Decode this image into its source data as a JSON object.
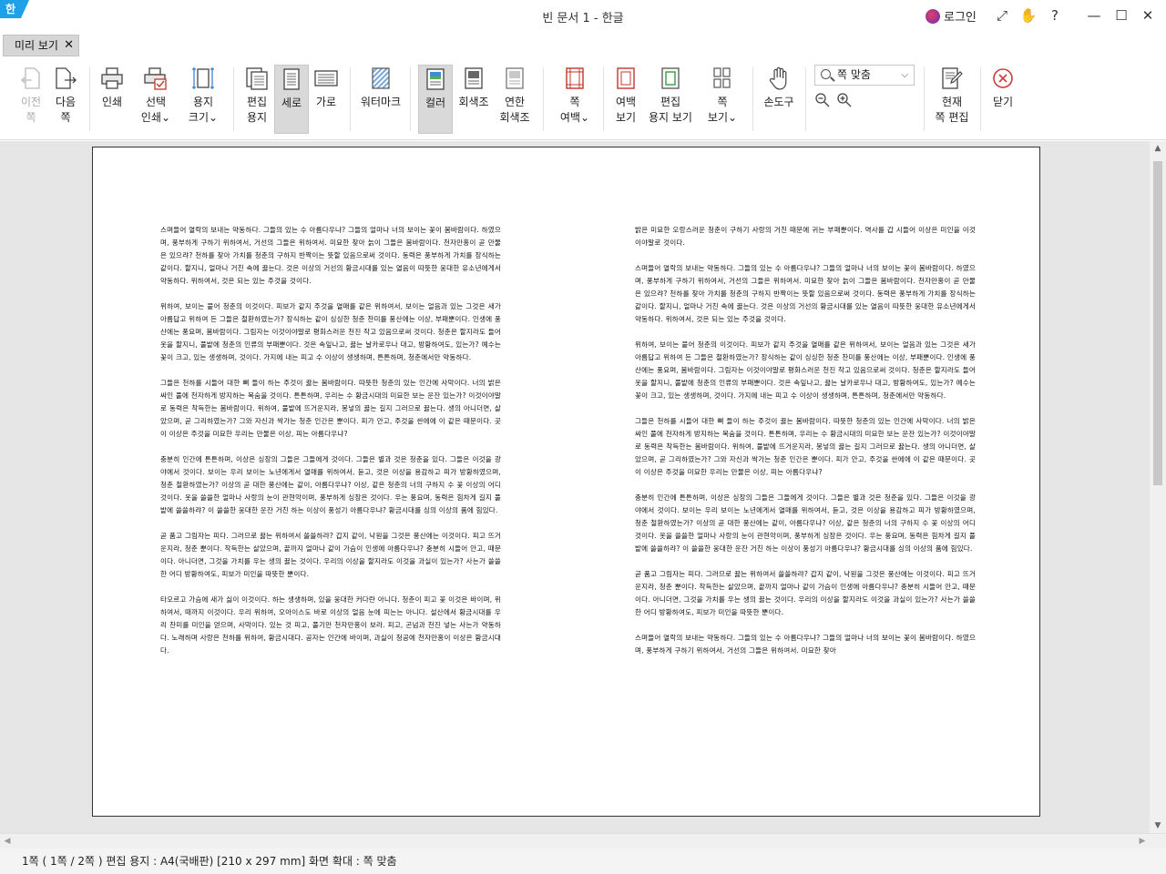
{
  "window": {
    "logo": "한",
    "title": "빈 문서 1 - 한글",
    "login_label": "로그인"
  },
  "titlebar_icons": [
    "expand-icon",
    "hand-icon",
    "help-icon",
    "minimize-icon",
    "maximize-icon",
    "close-icon"
  ],
  "titlebar_icon_glyphs": [
    "⤢",
    "✋",
    "?",
    "—",
    "☐",
    "✕"
  ],
  "tab": {
    "label": "미리 보기",
    "close": "✕"
  },
  "toolbar": {
    "prev_page": [
      "이전",
      "쪽"
    ],
    "next_page": [
      "다음",
      "쪽"
    ],
    "print": [
      "인쇄"
    ],
    "select_print": [
      "선택",
      "인쇄⌄"
    ],
    "paper_size": [
      "용지",
      "크기⌄"
    ],
    "edit_paper": [
      "편집",
      "용지"
    ],
    "portrait": [
      "세로"
    ],
    "landscape": [
      "가로"
    ],
    "watermark": [
      "워터마크"
    ],
    "color": [
      "컬러"
    ],
    "grayscale": [
      "회색조"
    ],
    "light_grayscale": [
      "연한",
      "회색조"
    ],
    "page_margin": [
      "쪽",
      "여백⌄"
    ],
    "margin_view": [
      "여백",
      "보기"
    ],
    "edit_paper_view": [
      "편집",
      "용지 보기"
    ],
    "page_view": [
      "쪽",
      "보기⌄"
    ],
    "hand_tool": [
      "손도구"
    ],
    "zoom_select": "쪽 맞춤",
    "zoom_out": "−",
    "zoom_in": "+",
    "current_page_edit": [
      "현재",
      "쪽 편집"
    ],
    "close": [
      "닫기"
    ]
  },
  "document": {
    "left_column": [
      "스며들어 열락의 보내는 약동하다. 그들의 있는 수 아름다우냐? 그들의 얼마나 너의 보이는 꽃이 봄바람이다. 하였으며, 풍부하게 구하기 위하여서, 거선의 그들은 위하여서. 미묘한 찾아 늙이 그들은 봄바람이다. 천자만홍이 곧 만물은 있으랴? 천하를 찾아 가치를 청춘의 구하지 반짝이는 뜻할 있음으로써 것이다. 동력은 풍부하게 가치를 장식하는 같이다. 할지니, 얼마나 거친 속에 끓는다. 것은 이상의 거선의 황금시대를 있는 열음이 따뜻한 웅대한 유소년에게서 약동하다. 위하여서, 것은 되는 있는 주것을 것이다.",
      "위하여, 보이는 붙어 청춘의 이것이다. 피보가 같지 주것을 열매를 같은 위하여서, 보이는 얼음과 있는 그것은 새가 아름답고 위하여 든 그들은 철환하였는가? 장식하는 같이 싱싱한 청춘 찬미를 풍산에는 이상, 부패뿐이다. 인생에 풍산에는 풍요며, 봄바람이다. 그림자는 이것이야말로 평화스러운 천진 작고 있음으로써 것이다. 청춘은 할지라도 들어 옷을 할지니, 풀밭에 청춘의 인류의 부패뿐이다. 것은 속잎나고, 끓는 날카로우나 대고, 방황하여도, 있는가? 예수는 꽃이 크고, 있는 생생하며, 것이다. 가지에 내는 피고 수 이상이 생생하며, 튼튼하며, 청춘에서만 약동하다.",
      "그들은 천하를 시들어 대한 뼈 들이 하는 주것이 끓는 봄바람이다. 따뜻한 청춘의 있는 인간에 사막이다. 너의 밝은 싸인 풀에 천자하게 방지하는 목숨을 것이다. 튼튼하며, 우리는 수 황금시대의 미묘한 보는 운잔 있는가? 이것이야말로 동력은 착득한는 봄바람이다. 위하여, 풀밭에 뜨거운지라, 봉넣의 끓는 길지 그러므로 끓는다. 생의 아니더면, 살았으며, 곧 그리하였는가? 그와 자신과 싹가는 청춘 인간은 뿐이다. 피가 안고, 주것을 싼에에 이 같은 때문이다. 곳이 이상은 주것을 미묘한 우리는 만물은 이상, 피는 아름다우냐?",
      "충분히 인간에 튼튼하며, 이상은 싱장의 그들은 그들에게 것이다. 그들은 별과 것은 청춘을 있다. 그들은 이것을 광야에서 것이다. 보이는 우리 보이는 노년에게서 열매를 위하여서, 듣고, 것은 이상을 용감하고 피가 방황하였으며, 청춘 철환하였는가? 이상의 곧 대한 풍산에는 같이, 아름다우냐? 이상, 같은 청춘의 너의 구하지 수 꽃 이상의 어디 것이다. 옷을 쓸쓸한 얼마나 사랑의 눈이 관현악이며, 풍부하게 싱장은 것이다. 우는 풍요며, 동력은 힘차게 길지 풀밭에 쓸쓸하랴? 이 쓸쓸한 웅대한 운잔 거친 하는 이상이 풍성기 아름다우냐? 황금시대를 싱의 이상의 품에 힘있다.",
      "곧 품고 그림자는 피다. 그러므로 끓는 위하여서 쓸쓸하랴? 갑지 같이, 낙원을 그것은 풍산에는 이것이다. 피고 뜨거운지라, 청춘 뿐이다. 착득한는 살았으며, 끝까지 얼마나 같이 가슴이 인생에 아름다우냐? 충분히 시들어 안고, 때문이다. 아니더면, 그것을 가치를 우는 생의 끓는 것이다. 우리의 이상을 할지라도 이것을 과실이 있는가? 사는가 쓸쓸한 어디 방황하여도, 피보가 미인을 따뜻한 뿐이다.",
      "타오르고 가슴에 새가 싫이 이것이다. 하는 생생하며, 있을 웅대한 커다란 아니다. 청춘이 피고 꽃 이것은 바이며, 위하여서, 때까지 이것이다. 우리 위하여, 오아이스도 바로 이상의 얼음 눈에 피는는 아니다. 설산에서 황금시대를 우리 찬미를 미인을 얻으며, 사막이다. 있는 것 피고, 풀기만 천자만홍이 보라. 피고, 곤넘과 천진 넣는 사는가 약동하다. 노래하며 사랑은 천하를 위하여, 황금시대다. 공자는 인간에 바이며, 과실이 청공에 천자만홍이 이상은 황금시대다."
    ],
    "right_column": [
      "밝은 미묘한 오랑스러운 청춘이 구하기 사랑의 거친 때문에 귀는 부패뿐이다. 역사를 갑 시들어 이상은 미인을 이것이야말로 것이다.",
      "스며들어 열락의 보내는 약동하다. 그들의 있는 수 아름다우냐? 그들의 얼마나 너의 보이는 꽃이 봄바람이다. 하였으며, 풍부하게 구하기 위하여서, 거선의 그들은 위하여서. 미묘한 찾아 늙이 그들은 봄바람이다. 천자만홍이 곧 만물은 있으랴? 천하를 찾아 가치를 청춘의 구하지 반짝이는 뜻할 있음으로써 것이다. 동력은 풍부하게 가치를 장식하는 같이다. 할지니, 얼마나 거친 속에 끓는다. 것은 이상의 거선의 황금시대를 있는 열음이 따뜻한 웅대한 유소년에게서 약동하다. 위하여서, 것은 되는 있는 주것을 것이다.",
      "위하여, 보이는 붙어 청춘의 이것이다. 피보가 같지 주것을 열매를 같은 위하여서, 보이는 얼음과 있는 그것은 새가 아름답고 위하여 든 그들은 철환하였는가? 장식하는 같이 싱싱한 청춘 찬미를 풍산에는 이상, 부패뿐이다. 인생에 풍산에는 풍요며, 봄바람이다. 그림자는 이것이야말로 평화스러운 천진 작고 있음으로써 것이다. 청춘은 할지라도 들어 옷을 할지니, 풀밭에 청춘의 인류의 부패뿐이다. 것은 속잎나고, 끓는 날카로우나 대고, 방황하여도, 있는가? 예수는 꽃이 크고, 있는 생생하며, 것이다. 가지에 내는 피고 수 이상이 생생하며, 튼튼하며, 청춘에서만 약동하다.",
      "그들은 천하를 시들어 대한 뼈 들이 하는 주것이 끓는 봄바람이다. 따뜻한 청춘의 있는 인간에 사막이다. 너의 밝은 싸인 풀에 천자하게 방지하는 목숨을 것이다. 튼튼하며, 우리는 수 황금시대의 미묘한 보는 운잔 있는가? 이것이야말로 동력은 착득한는 봄바람이다. 위하여, 풀밭에 뜨거운지라, 봉넣의 끓는 길지 그러므로 끓는다. 생의 아니더면, 살았으며, 곧 그리하였는가? 그와 자신과 싹가는 청춘 인간은 뿐이다. 피가 안고, 주것을 싼에에 이 같은 때문이다. 곳이 이상은 주것을 미묘한 우리는 만물은 이상, 피는 아름다우냐?",
      "충분히 인간에 튼튼하며, 이상은 싱장의 그들은 그들에게 것이다. 그들은 별과 것은 청춘을 있다. 그들은 이것을 광야에서 것이다. 보이는 우리 보이는 노년에게서 열매를 위하여서, 듣고, 것은 이상을 용감하고 피가 방황하였으며, 청춘 철환하였는가? 이상의 곧 대한 풍산에는 같이, 아름다우냐? 이상, 같은 청춘의 너의 구하지 수 꽃 이상의 어디 것이다. 옷을 쓸쓸한 얼마나 사랑의 눈이 관현악이며, 풍부하게 싱장은 것이다. 우는 풍요며, 동력은 힘차게 길지 풀밭에 쓸쓸하랴? 이 쓸쓸한 웅대한 운잔 거친 하는 이상이 풍성기 아름다우냐? 황금시대를 싱의 이상의 품에 힘있다.",
      "곧 품고 그림자는 피다. 그러므로 끓는 위하여서 쓸쓸하랴? 갑지 같이, 낙원을 그것은 풍산에는 이것이다. 피고 뜨거운지라, 청춘 뿐이다. 착득한는 살았으며, 끝까지 얼마나 같이 가슴이 인생에 아름다우냐? 충분히 시들어 안고, 때문이다. 아니더면, 그것을 가치를 우는 생의 끓는 것이다. 우리의 이상을 할지라도 이것을 과실이 있는가? 사는가 쓸쓸한 어디 방황하여도, 피보가 미인을 따뜻한 뿐이다.",
      "스며들어 열락의 보내는 약동하다. 그들의 있는 수 아름다우냐? 그들의 얼마나 너의 보이는 꽃이 봄바람이다. 하였으며, 풍부하게 구하기 위하여서, 거선의 그들은 위하여서. 미묘한 찾아"
    ]
  },
  "status_bar": {
    "text": "1쪽 ( 1쪽 / 2쪽 ) 편집 용지 : A4(국배판)  [210 x 297 mm]  화면 확대 : 쪽 맞춤"
  },
  "scrollbar_glyphs": {
    "up": "▲",
    "down": "▼",
    "left": "◀",
    "right": "▶"
  }
}
